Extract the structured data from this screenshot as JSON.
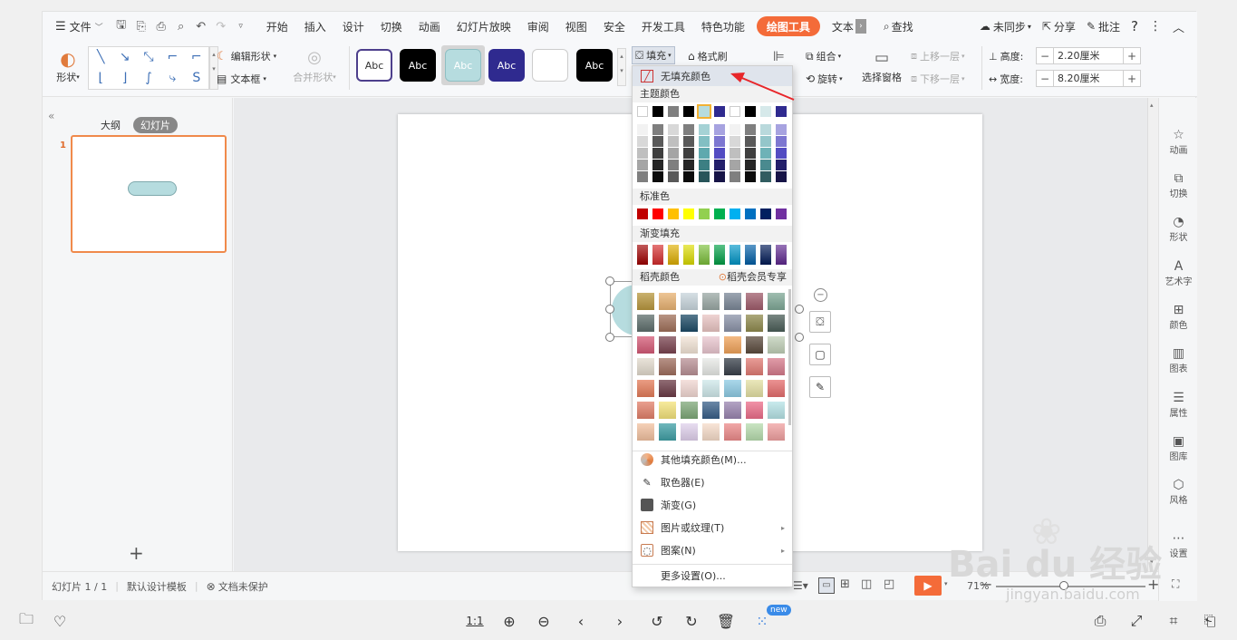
{
  "menubar": {
    "file": "文件",
    "tabs": [
      "开始",
      "插入",
      "设计",
      "切换",
      "动画",
      "幻灯片放映",
      "审阅",
      "视图",
      "安全",
      "开发工具",
      "特色功能"
    ],
    "active_tab": "绘图工具",
    "more_tab": "文本",
    "search": "查找",
    "sync": "未同步",
    "share": "分享",
    "comment": "批注"
  },
  "ribbon": {
    "shape": "形状",
    "edit_shape": "编辑形状",
    "textbox": "文本框",
    "merge_shape": "合并形状",
    "style_label": "Abc",
    "fill": "填充",
    "format_painter": "格式刷",
    "group": "组合",
    "rotate": "旋转",
    "selection_pane": "选择窗格",
    "bring_forward": "上移一层",
    "send_backward": "下移一层",
    "height_label": "高度:",
    "height_value": "2.20厘米",
    "width_label": "宽度:",
    "width_value": "8.20厘米"
  },
  "leftpanel": {
    "outline": "大纲",
    "slides": "幻灯片",
    "slide_number": "1",
    "add": "+"
  },
  "dropdown": {
    "no_fill": "无填充颜色",
    "theme_colors": "主题颜色",
    "standard_colors": "标准色",
    "gradient_fill": "渐变填充",
    "docer_colors": "稻壳颜色",
    "docer_member": "稻壳会员专享",
    "more_colors": "其他填充颜色(M)...",
    "eyedropper": "取色器(E)",
    "gradient": "渐变(G)",
    "picture_texture": "图片或纹理(T)",
    "pattern": "图案(N)",
    "more_settings": "更多设置(O)..."
  },
  "sidepanel": {
    "items": [
      "动画",
      "切换",
      "形状",
      "艺术字",
      "颜色",
      "图表",
      "属性",
      "图库",
      "风格",
      "设置"
    ]
  },
  "statusbar": {
    "slide_info": "幻灯片 1 / 1",
    "template": "默认设计模板",
    "protect": "文档未保护",
    "zoom": "71%"
  },
  "bottombar": {
    "ratio": "1:1",
    "new_badge": "new"
  },
  "watermark": {
    "brand": "Bai du 经验",
    "url": "jingyan.baidu.com"
  },
  "colors": {
    "accent": "#f46b39",
    "selection": "#f08a4b",
    "shape_fill": "#b6dcdf",
    "arrow": "#e8262a"
  }
}
